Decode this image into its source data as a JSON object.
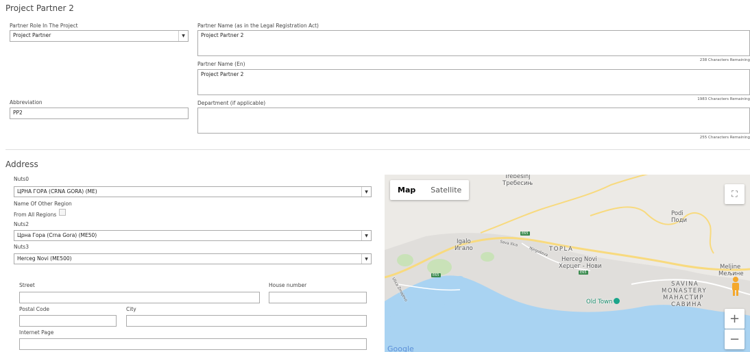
{
  "partner": {
    "section_title": "Project Partner 2",
    "role_label": "Partner Role In The Project",
    "role_value": "Project Partner",
    "name_legal_label": "Partner Name (as in the Legal Registration Act)",
    "name_legal_value": "Project Partner 2",
    "name_legal_counter": "238 Characters Remaining",
    "name_en_label": "Partner Name (En)",
    "name_en_value": "Project Partner 2",
    "name_en_counter": "1983 Characters Remaining",
    "abbreviation_label": "Abbreviation",
    "abbreviation_value": "PP2",
    "department_label": "Department (if applicable)",
    "department_value": "",
    "department_counter": "255 Characters Remaining"
  },
  "address": {
    "section_title": "Address",
    "nuts0_label": "Nuts0",
    "nuts0_value": "ЦРНА ГОРА (CRNA GORA) (ME)",
    "other_region_label": "Name Of Other Region",
    "all_regions_label": "From All Regions",
    "nuts2_label": "Nuts2",
    "nuts2_value": "Црна Гора (Crna Gora) (ME50)",
    "nuts3_label": "Nuts3",
    "nuts3_value": "Herceg Novi (ME500)",
    "street_label": "Street",
    "house_number_label": "House number",
    "postal_code_label": "Postal Code",
    "city_label": "City",
    "internet_page_label": "Internet Page"
  },
  "map": {
    "type_map": "Map",
    "type_satellite": "Satellite",
    "labels": {
      "trebesinj": "Trebesinj",
      "trebesinj_cyr": "Требесињ",
      "podi": "Podi",
      "podi_cyr": "Поди",
      "igalo": "Igalo",
      "igalo_cyr": "Игало",
      "topla": "TOPLA",
      "herceg_novi": "Herceg Novi",
      "herceg_novi_cyr": "Херцег - Нови",
      "meljine": "Meljine",
      "meljine_cyr": "Мељине",
      "savina": "SAVINA",
      "monastery": "MONASTERY",
      "manastir": "МАНАСТИР",
      "savina_cyr": "САВИНА",
      "old_town": "Old Town",
      "sava_ilica": "Sava Ilica",
      "njegoseva": "Njegoševa",
      "ulica_zmajevo": "Ulica Zmajevo",
      "google": "Google"
    },
    "road": "E65",
    "colors": {
      "water": "#a9d3f2",
      "land": "#eceae6",
      "urban": "#e0dedb",
      "road": "#f8da7e",
      "park": "#c9e2b8"
    }
  }
}
